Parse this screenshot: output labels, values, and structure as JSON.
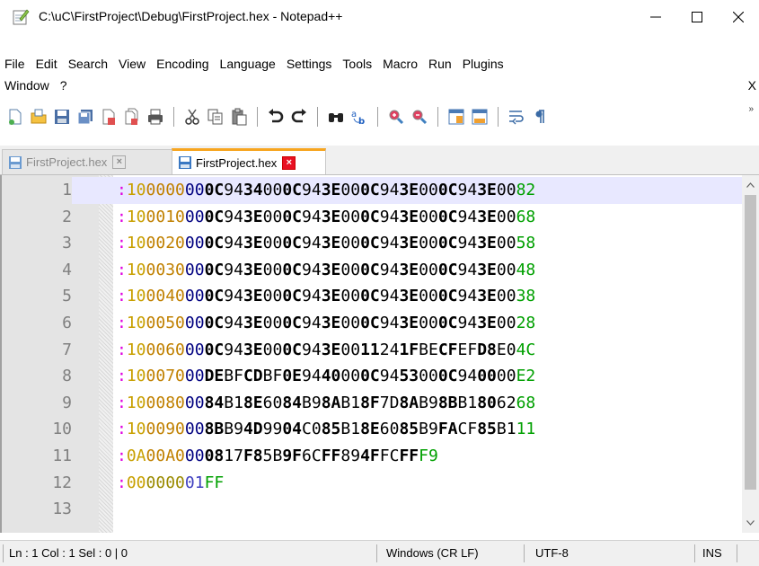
{
  "window": {
    "title": "C:\\uC\\FirstProject\\Debug\\FirstProject.hex - Notepad++",
    "minimize_glyph": "—",
    "maximize_glyph": "☐",
    "close_glyph": "✕"
  },
  "menu": {
    "row1": [
      "File",
      "Edit",
      "Search",
      "View",
      "Encoding",
      "Language",
      "Settings",
      "Tools",
      "Macro",
      "Run",
      "Plugins"
    ],
    "row2": [
      "Window",
      "?"
    ],
    "overflow": "X"
  },
  "toolbar": {
    "icons": [
      "new-file-icon",
      "open-file-icon",
      "save-icon",
      "save-all-icon",
      "close-icon",
      "close-all-icon",
      "print-icon",
      "cut-icon",
      "copy-icon",
      "paste-icon",
      "undo-icon",
      "redo-icon",
      "find-icon",
      "replace-icon",
      "zoom-in-icon",
      "zoom-out-icon",
      "sync-vertical-icon",
      "sync-horizontal-icon",
      "word-wrap-icon",
      "show-all-chars-icon"
    ],
    "more": "»"
  },
  "tabs": [
    {
      "label": "FirstProject.hex",
      "active": false
    },
    {
      "label": "FirstProject.hex",
      "active": true
    }
  ],
  "editor": {
    "lines": [
      {
        "num": "1",
        "colon": ":",
        "count": "10",
        "addr": "0000",
        "type": "00",
        "data": "0C9434000C943E000C943E000C943E00",
        "cks": "82"
      },
      {
        "num": "2",
        "colon": ":",
        "count": "10",
        "addr": "0010",
        "type": "00",
        "data": "0C943E000C943E000C943E000C943E00",
        "cks": "68"
      },
      {
        "num": "3",
        "colon": ":",
        "count": "10",
        "addr": "0020",
        "type": "00",
        "data": "0C943E000C943E000C943E000C943E00",
        "cks": "58"
      },
      {
        "num": "4",
        "colon": ":",
        "count": "10",
        "addr": "0030",
        "type": "00",
        "data": "0C943E000C943E000C943E000C943E00",
        "cks": "48"
      },
      {
        "num": "5",
        "colon": ":",
        "count": "10",
        "addr": "0040",
        "type": "00",
        "data": "0C943E000C943E000C943E000C943E00",
        "cks": "38"
      },
      {
        "num": "6",
        "colon": ":",
        "count": "10",
        "addr": "0050",
        "type": "00",
        "data": "0C943E000C943E000C943E000C943E00",
        "cks": "28"
      },
      {
        "num": "7",
        "colon": ":",
        "count": "10",
        "addr": "0060",
        "type": "00",
        "data": "0C943E000C943E0011241FBECFEFD8E0",
        "cks": "4C"
      },
      {
        "num": "8",
        "colon": ":",
        "count": "10",
        "addr": "0070",
        "type": "00",
        "data": "DEBFCDBF0E9440000C9453000C940000",
        "cks": "E2"
      },
      {
        "num": "9",
        "colon": ":",
        "count": "10",
        "addr": "0080",
        "type": "00",
        "data": "84B18E6084B98AB18F7D8AB98BB18062",
        "cks": "68"
      },
      {
        "num": "10",
        "colon": ":",
        "count": "10",
        "addr": "0090",
        "type": "00",
        "data": "8BB94D9904C085B18E6085B9FACF85B1",
        "cks": "11"
      },
      {
        "num": "11",
        "colon": ":",
        "count": "0A",
        "addr": "00A0",
        "type": "00",
        "data": "0817F85B9F6CFF894FFCFF",
        "cks": "F9"
      },
      {
        "num": "12",
        "colon": ":",
        "count": "00",
        "addr": "0000",
        "type": "01",
        "data": "",
        "cks": "FF"
      },
      {
        "num": "13",
        "colon": "",
        "count": "",
        "addr": "",
        "type": "",
        "data": "",
        "cks": ""
      }
    ]
  },
  "statusbar": {
    "position": "Ln : 1    Col : 1    Sel : 0 | 0",
    "eol": "Windows (CR LF)",
    "encoding": "UTF-8",
    "mode": "INS"
  }
}
